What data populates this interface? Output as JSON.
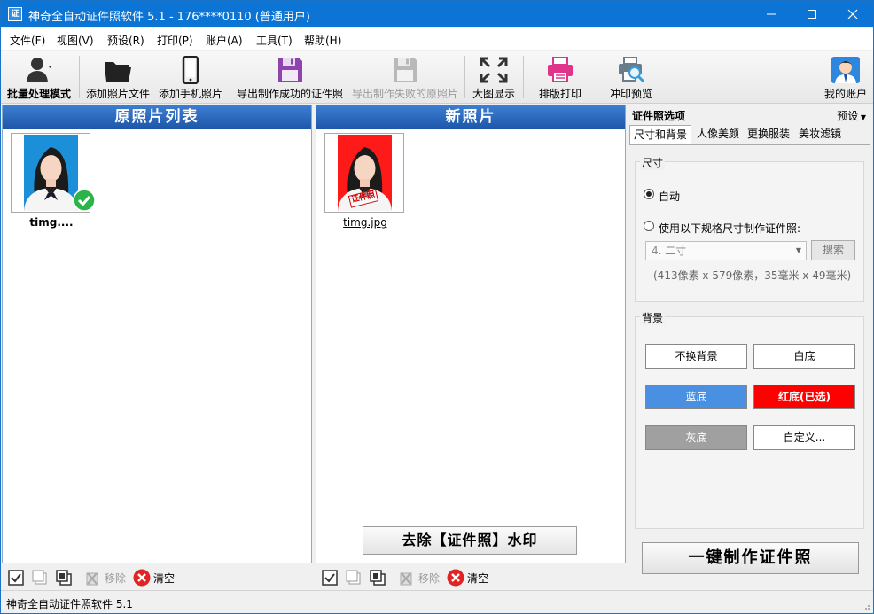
{
  "window": {
    "title": "神奇全自动证件照软件 5.1 - 176****0110 (普通用户)",
    "icon_text": "证",
    "minimize_icon": "minimize-icon",
    "maximize_icon": "maximize-icon",
    "close_icon": "close-icon"
  },
  "menu": [
    "文件(F)",
    "视图(V)",
    "预设(R)",
    "打印(P)",
    "账户(A)",
    "工具(T)",
    "帮助(H)"
  ],
  "toolbar": {
    "batch_mode": "批量处理模式",
    "add_file": "添加照片文件",
    "add_phone": "添加手机照片",
    "export_success": "导出制作成功的证件照",
    "export_failed": "导出制作失败的原照片",
    "big_view": "大图显示",
    "layout_print": "排版打印",
    "print_preview": "冲印预览",
    "my_account": "我的账户"
  },
  "left_panel": {
    "title": "原照片列表",
    "photos": [
      {
        "name": "timg....",
        "status": "success"
      }
    ]
  },
  "middle_panel": {
    "title": "新照片",
    "photos": [
      {
        "name": "timg.jpg",
        "stamp": "证件照"
      }
    ],
    "watermark_button": "去除【证件照】水印"
  },
  "bottom_actions": {
    "remove": "移除",
    "clear": "清空"
  },
  "right_panel": {
    "title": "证件照选项",
    "preset": "预设",
    "tabs": [
      "尺寸和背景",
      "人像美颜",
      "更换服装",
      "美妆滤镜"
    ],
    "active_tab": 0,
    "size": {
      "group_label": "尺寸",
      "auto": "自动",
      "custom": "使用以下规格尺寸制作证件照:",
      "selected_option": "4. 二寸",
      "search": "搜索",
      "info": "(413像素 x 579像素，35毫米 x 49毫米)"
    },
    "background": {
      "group_label": "背景",
      "no_change": "不换背景",
      "white": "白底",
      "blue": "蓝底",
      "red": "红底(已选)",
      "gray": "灰底",
      "custom": "自定义..."
    },
    "make_button": "一键制作证件照"
  },
  "colors": {
    "titlebar": "#0b74d4",
    "panel_header": "#1c56a8",
    "blue_bg": "#4a90e2",
    "red_bg": "#ff0000",
    "gray_bg": "#a0a0a0",
    "photo_blue": "#1b8fd8",
    "photo_red": "#ff1a1a"
  },
  "status": "神奇全自动证件照软件 5.1"
}
